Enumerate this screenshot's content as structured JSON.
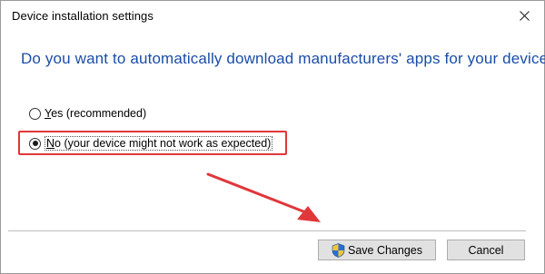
{
  "window": {
    "title": "Device installation settings",
    "close_icon": "close-icon"
  },
  "question": "Do you want to automatically download manufacturers' apps for your devices?",
  "options": [
    {
      "mnemonic": "Y",
      "rest": "es (recommended)",
      "selected": false
    },
    {
      "mnemonic": "N",
      "rest": "o (your device might not work as expected)",
      "selected": true
    }
  ],
  "annotation": {
    "highlight_color": "#e0373a",
    "arrow_color": "#e0373a"
  },
  "buttons": {
    "save_label": "Save Changes",
    "save_icon": "uac-shield-icon",
    "cancel_label": "Cancel"
  },
  "colors": {
    "question_text": "#1a4da8",
    "button_face": "#e1e1e1"
  }
}
